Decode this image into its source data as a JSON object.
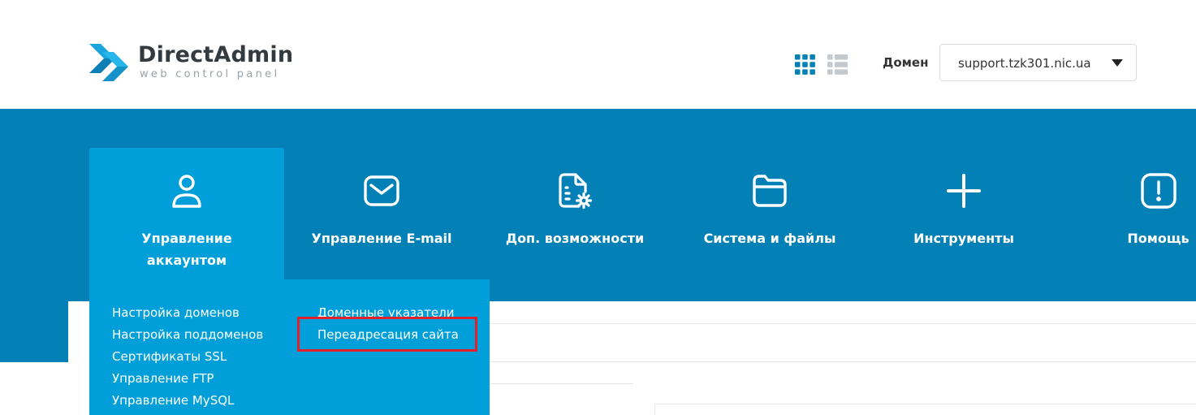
{
  "header": {
    "logo": {
      "title": "DirectAdmin",
      "subtitle": "web control panel"
    },
    "view_toggles": [
      "grid-view-icon",
      "list-view-icon"
    ],
    "domain": {
      "label": "Домен",
      "selected": "support.tzk301.nic.ua"
    }
  },
  "nav": {
    "items": [
      {
        "label": "Управление аккаунтом",
        "icon": "user-icon",
        "active": true
      },
      {
        "label": "Управление E-mail",
        "icon": "envelope-icon",
        "active": false
      },
      {
        "label": "Доп. возможности",
        "icon": "document-gear-icon",
        "active": false
      },
      {
        "label": "Система и файлы",
        "icon": "folder-icon",
        "active": false
      },
      {
        "label": "Инструменты",
        "icon": "plus-icon",
        "active": false
      },
      {
        "label": "Помощь",
        "icon": "alert-icon",
        "active": false
      }
    ]
  },
  "submenu": {
    "col1": [
      "Настройка доменов",
      "Настройка поддоменов",
      "Сертификаты SSL",
      "Управление FTP",
      "Управление MySQL"
    ],
    "col2": [
      "Доменные указатели",
      "Переадресация сайта"
    ],
    "highlighted": "Переадресация сайта"
  },
  "colors": {
    "band": "#0381b6",
    "active_tab": "#019fd9",
    "highlight": "#e0202a",
    "toggle_active": "#0381b6",
    "toggle_inactive": "#c4c9ce"
  }
}
